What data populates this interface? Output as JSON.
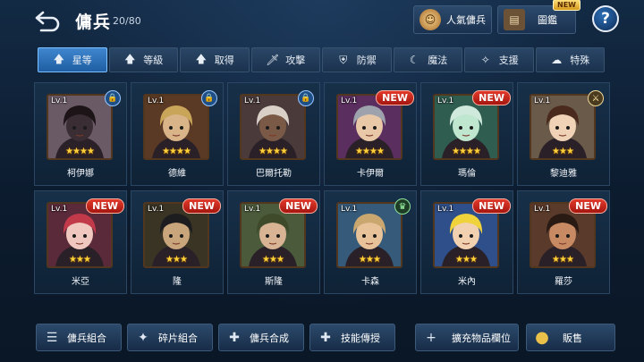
{
  "header": {
    "title": "傭兵",
    "count": "20/80",
    "popular_label": "人氣傭兵",
    "book_label": "圖鑑",
    "book_badge": "NEW",
    "help_label": "?"
  },
  "tabs": [
    {
      "label": "星等",
      "icon": "arrow-up-icon",
      "active": true
    },
    {
      "label": "等級",
      "icon": "arrow-up-icon",
      "active": false
    },
    {
      "label": "取得",
      "icon": "arrow-up-icon",
      "active": false
    },
    {
      "label": "攻擊",
      "icon": "sword-icon",
      "active": false
    },
    {
      "label": "防禦",
      "icon": "shield-icon",
      "active": false
    },
    {
      "label": "魔法",
      "icon": "magic-icon",
      "active": false
    },
    {
      "label": "支援",
      "icon": "support-icon",
      "active": false
    },
    {
      "label": "特殊",
      "icon": "special-icon",
      "active": false
    }
  ],
  "heroes": [
    {
      "name": "柯伊娜",
      "level": "Lv.1",
      "stars": "★★★★",
      "tag": "lock",
      "tag_text": "🔒",
      "skin": "#3a2d33",
      "hair": "#1c1416",
      "bg": "#6a5a66"
    },
    {
      "name": "德維",
      "level": "Lv.1",
      "stars": "★★★★",
      "tag": "lock",
      "tag_text": "🔒",
      "skin": "#d8b488",
      "hair": "#c9a55a",
      "bg": "#5a3a24"
    },
    {
      "name": "巴爾托勒",
      "level": "Lv.1",
      "stars": "★★★★",
      "tag": "lock",
      "tag_text": "🔒",
      "skin": "#7a5a46",
      "hair": "#d9d1c8",
      "bg": "#4a3a3a"
    },
    {
      "name": "卡伊爾",
      "level": "Lv.1",
      "stars": "★★★★",
      "tag": "new",
      "tag_text": "NEW",
      "skin": "#e9c8a8",
      "hair": "#9da2ad",
      "bg": "#5a2e5e"
    },
    {
      "name": "瑪倫",
      "level": "Lv.1",
      "stars": "★★★★",
      "tag": "new",
      "tag_text": "NEW",
      "skin": "#bfe6cf",
      "hair": "#cfeadc",
      "bg": "#2f5d4f"
    },
    {
      "name": "黎迪雅",
      "level": "Lv.1",
      "stars": "★★★",
      "tag": "sword",
      "tag_text": "⚔",
      "skin": "#f0d2b6",
      "hair": "#4a2a1c",
      "bg": "#6a5a4a"
    },
    {
      "name": "米亞",
      "level": "Lv.1",
      "stars": "★★★",
      "tag": "new",
      "tag_text": "NEW",
      "skin": "#f1c8c0",
      "hair": "#c23a4a",
      "bg": "#5a2a3a"
    },
    {
      "name": "隆",
      "level": "Lv.1",
      "stars": "★★★",
      "tag": "new",
      "tag_text": "NEW",
      "skin": "#c9a57c",
      "hair": "#1d1d1f",
      "bg": "#3a3424"
    },
    {
      "name": "斯隆",
      "level": "Lv.1",
      "stars": "★★★",
      "tag": "new",
      "tag_text": "NEW",
      "skin": "#d9b494",
      "hair": "#3e4a2a",
      "bg": "#4a5a3a"
    },
    {
      "name": "卡森",
      "level": "Lv.1",
      "stars": "★★★",
      "tag": "crown",
      "tag_text": "♛",
      "skin": "#e8c39a",
      "hair": "#c9a76e",
      "bg": "#355a7a"
    },
    {
      "name": "米內",
      "level": "Lv.1",
      "stars": "★★★",
      "tag": "new",
      "tag_text": "NEW",
      "skin": "#f1d1b0",
      "hair": "#f0d23a",
      "bg": "#2e4f8a"
    },
    {
      "name": "羅莎",
      "level": "Lv.1",
      "stars": "★★★",
      "tag": "new",
      "tag_text": "NEW",
      "skin": "#c88a62",
      "hair": "#2a1a14",
      "bg": "#5a3a2a"
    }
  ],
  "bottom": [
    {
      "label": "傭兵組合",
      "icon": "team-icon",
      "glyph": "☰"
    },
    {
      "label": "碎片組合",
      "icon": "puzzle-icon",
      "glyph": "✦"
    },
    {
      "label": "傭兵合成",
      "icon": "merge-icon",
      "glyph": "✚"
    },
    {
      "label": "技能傳授",
      "icon": "skill-transfer-icon",
      "glyph": "✚"
    },
    {
      "label": "擴充物品欄位",
      "icon": "plus-icon",
      "glyph": "+"
    },
    {
      "label": "販售",
      "icon": "coin-icon",
      "glyph": "●"
    }
  ]
}
